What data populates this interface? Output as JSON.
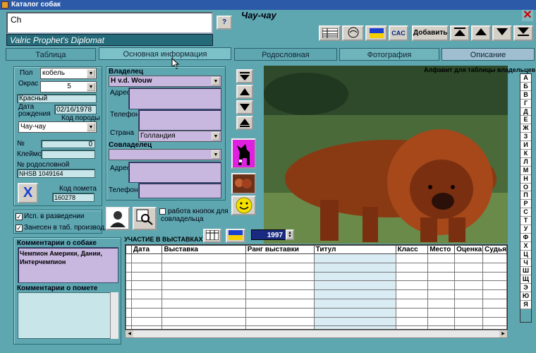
{
  "window": {
    "title": "Каталог собак"
  },
  "header": {
    "search_value": "Ch",
    "dog_name": "Valric Prophet's Diplomat",
    "help_label": "?",
    "breed_title": "Чау-чау"
  },
  "toolbar": {
    "cac_label": "CAC",
    "add_label": "Добавить"
  },
  "tabs": [
    {
      "label": "Таблица"
    },
    {
      "label": "Основная информация"
    },
    {
      "label": "Родословная"
    },
    {
      "label": "Фотография"
    },
    {
      "label": "Описание"
    }
  ],
  "dog": {
    "sex_label": "Пол",
    "sex": "кобель",
    "color_label": "Окрас",
    "color_num": "5",
    "color_name": "Красный",
    "dob_label": "Дата рождения",
    "dob": "02/16/1978",
    "breed_code_label": "Код породы",
    "breed": "Чау-чау",
    "num_label": "№",
    "num": "0",
    "brand_label": "Клеймо",
    "brand": "",
    "pedigree_label": "№ родословной",
    "pedigree": "NHSB 1049164",
    "litter_code_label": "Код помета",
    "litter_code": "160278",
    "x_label": "X",
    "breeding_label": "Исп. в разведении",
    "breeding_checked": true,
    "registered_label": "Занесен в таб. производ.",
    "registered_checked": true
  },
  "owner": {
    "owner_label": "Владелец",
    "owner": "H v.d. Wouw",
    "address_label": "Адрес",
    "phone_label": "Телефон",
    "country_label": "Страна",
    "country": "Голландия",
    "coowner_label": "Совладелец",
    "co_address_label": "Адрес",
    "co_phone_label": "Телефон",
    "coowner_buttons_label": "работа кнопок для совладельца"
  },
  "alphabet": {
    "title": "Алфавит для таблицы владельцев",
    "letters": [
      "А",
      "Б",
      "В",
      "Г",
      "Д",
      "Е",
      "Ж",
      "З",
      "И",
      "К",
      "Л",
      "М",
      "Н",
      "О",
      "П",
      "Р",
      "С",
      "Т",
      "У",
      "Ф",
      "Х",
      "Ц",
      "Ч",
      "Ш",
      "Щ",
      "Э",
      "Ю",
      "Я"
    ]
  },
  "comments": {
    "dog_label": "Комментарии о собаке",
    "dog_text": "Чемпион Америки, Дании, Интерчемпион",
    "litter_label": "Комментарии о помете",
    "litter_text": ""
  },
  "shows": {
    "title": "УЧАСТИЕ В ВЫСТАВКАХ",
    "year": "1997",
    "columns": [
      "Дата",
      "Выставка",
      "Ранг выставки",
      "Титул",
      "Класс",
      "Место",
      "Оценка",
      "Судья"
    ],
    "row_count": 10
  },
  "icons": {
    "flag_blue": "#1a3fd0",
    "flag_yellow": "#f5d000"
  }
}
